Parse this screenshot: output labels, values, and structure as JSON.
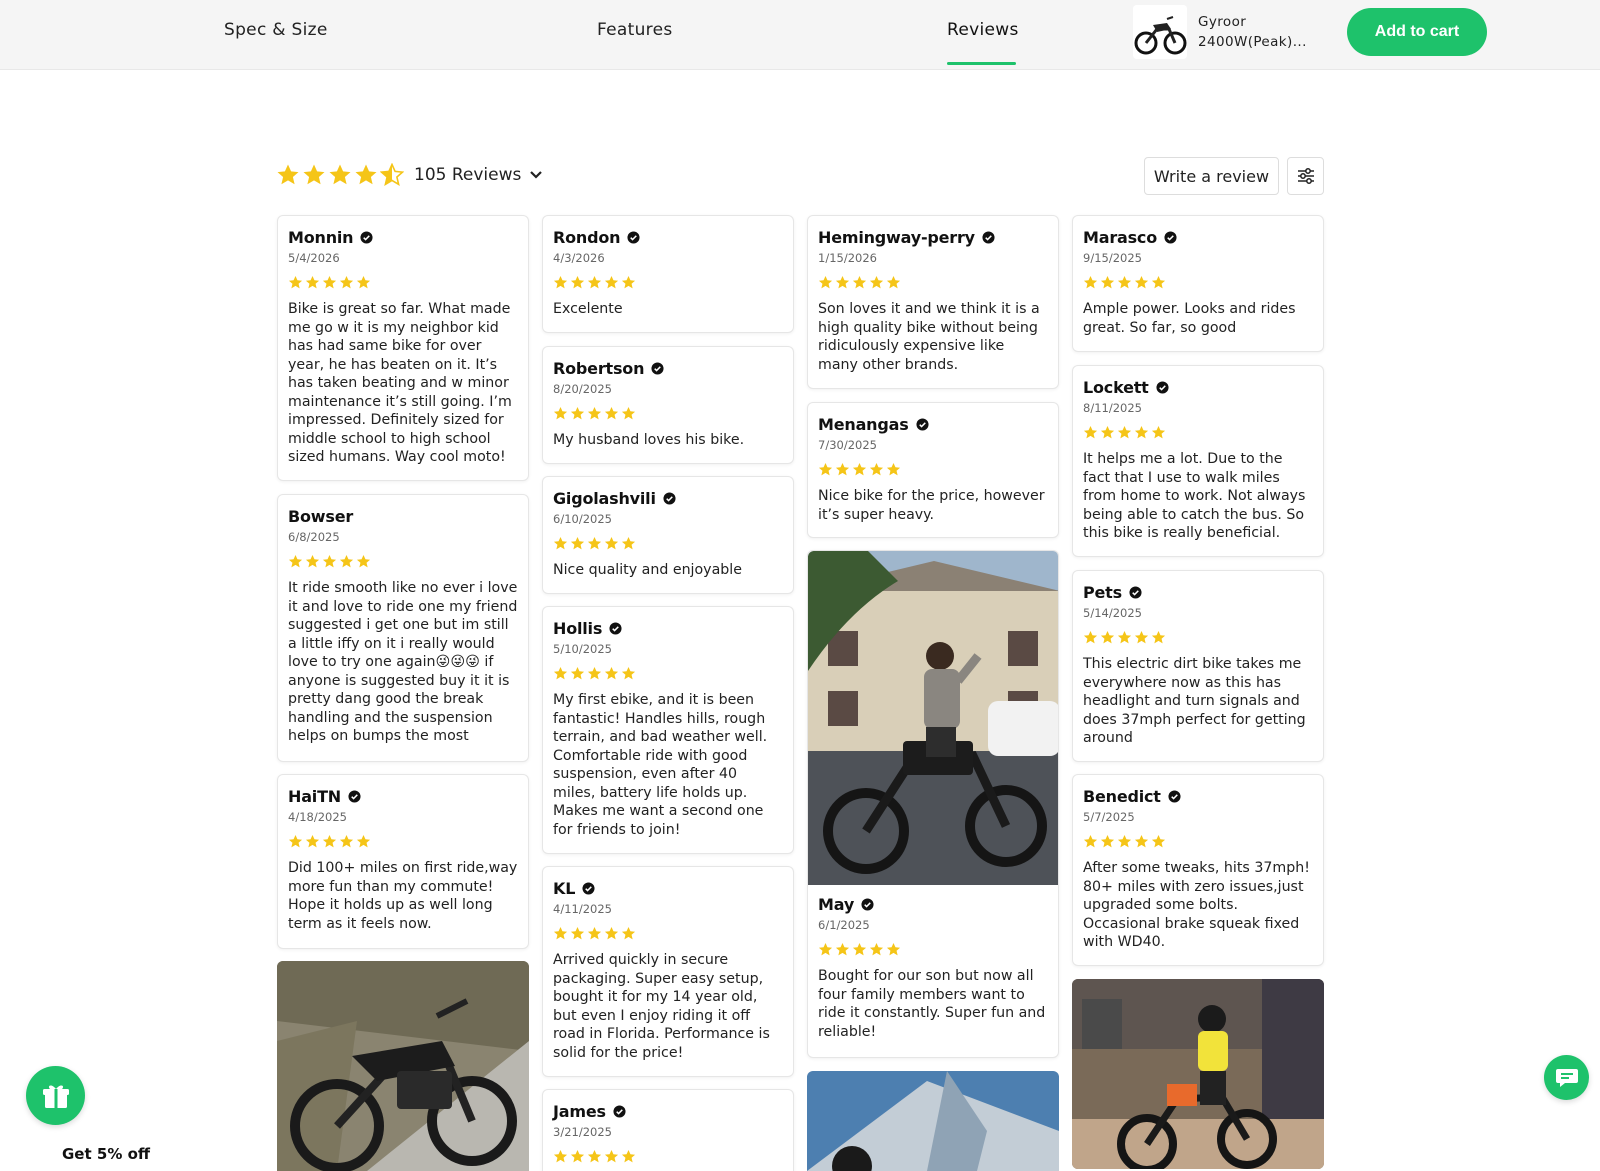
{
  "nav": {
    "tabs": [
      {
        "label": "Spec & Size"
      },
      {
        "label": "Features"
      },
      {
        "label": "Reviews"
      }
    ],
    "product": {
      "name": "Gyroor 2400W(Peak)..."
    },
    "add_to_cart": "Add to cart"
  },
  "summary": {
    "rating": 4.5,
    "reviews_label": "105 Reviews",
    "write_review": "Write a review"
  },
  "reviews": [
    {
      "name": "Monnin",
      "date": "5/4/2026",
      "rating": 5,
      "text": "Bike is great so far. What made me go w it is my neighbor kid has had same bike for over year, he has beaten on it. It’s has taken beating and w minor maintenance it’s still going. I’m impressed.  Definitely sized for middle school to high school sized humans. Way cool moto!"
    },
    {
      "name": "Bowser",
      "date": "6/8/2025",
      "rating": 5,
      "text": "It ride smooth like no ever i love it and love to ride one my friend suggested i get one but im still a little iffy on it i really would love to try one again😜😜😜 if anyone is suggested buy it it is pretty dang good the break handling and the suspension helps on bumps the most"
    },
    {
      "name": "HaiTN",
      "date": "4/18/2025",
      "rating": 5,
      "text": "Did 100+ miles on first ride,way more fun than my commute! Hope it holds up as well long term as it feels now."
    },
    {
      "name": "Rondon",
      "date": "4/3/2026",
      "rating": 5,
      "text": "Excelente"
    },
    {
      "name": "Robertson",
      "date": "8/20/2025",
      "rating": 5,
      "text": "My husband loves his bike."
    },
    {
      "name": "Gigolashvili",
      "date": "6/10/2025",
      "rating": 5,
      "text": "Nice quality and enjoyable"
    },
    {
      "name": "Hollis",
      "date": "5/10/2025",
      "rating": 5,
      "text": "My first ebike, and it is been fantastic! Handles hills, rough terrain, and bad weather well. Comfortable ride with good suspension, even after 40 miles, battery life holds up. Makes me want a second one for friends to join!"
    },
    {
      "name": "KL",
      "date": "4/11/2025",
      "rating": 5,
      "text": "Arrived quickly in secure packaging. Super easy setup, bought it for my 14 year old, but even I enjoy riding it off road in Florida. Performance is solid for the price!"
    },
    {
      "name": "James",
      "date": "3/21/2025",
      "rating": 5,
      "text": ""
    },
    {
      "name": "Hemingway-perry",
      "date": "1/15/2026",
      "rating": 5,
      "text": "Son loves it and we think it is a high quality bike without being ridiculously expensive like many other brands."
    },
    {
      "name": "Menangas",
      "date": "7/30/2025",
      "rating": 5,
      "text": "Nice bike for the price, however it’s super heavy."
    },
    {
      "name": "May",
      "date": "6/1/2025",
      "rating": 5,
      "text": "Bought for our son but now all four family members want to ride it constantly. Super fun and reliable!"
    },
    {
      "name": "Marasco",
      "date": "9/15/2025",
      "rating": 5,
      "text": "Ample power. Looks and rides great. So far, so good"
    },
    {
      "name": "Lockett",
      "date": "8/11/2025",
      "rating": 5,
      "text": "It helps me a lot. Due to the fact that I use to walk miles from home to work. Not always being able to catch the bus. So this bike is really beneficial."
    },
    {
      "name": "Pets",
      "date": "5/14/2025",
      "rating": 5,
      "text": "This electric dirt bike takes me everywhere now as this has headlight and turn signals and does 37mph perfect for getting around"
    },
    {
      "name": "Benedict",
      "date": "5/7/2025",
      "rating": 5,
      "text": "After some tweaks, hits 37mph! 80+ miles with zero issues,just upgraded some bolts. Occasional brake squeak fixed with WD40."
    }
  ],
  "promo": {
    "label": "Get 5% off"
  },
  "colors": {
    "accent": "#1ec26b",
    "star": "#f5c518"
  },
  "icons": [
    "gift-icon",
    "chat-icon",
    "filter-icon",
    "chevron-down-icon",
    "verified-icon",
    "star-icon"
  ]
}
